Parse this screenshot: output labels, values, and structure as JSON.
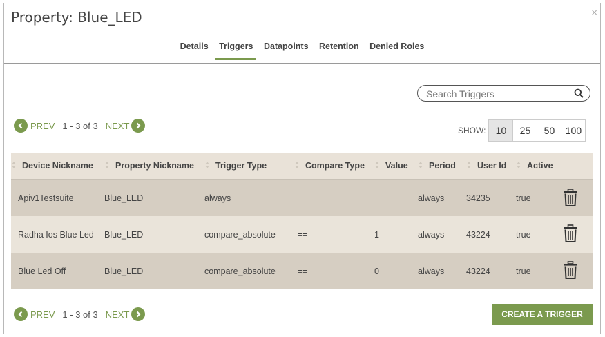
{
  "dialog": {
    "title": "Property: Blue_LED",
    "close_glyph": "×"
  },
  "tabs": [
    {
      "label": "Details",
      "active": false
    },
    {
      "label": "Triggers",
      "active": true
    },
    {
      "label": "Datapoints",
      "active": false
    },
    {
      "label": "Retention",
      "active": false
    },
    {
      "label": "Denied Roles",
      "active": false
    }
  ],
  "search": {
    "placeholder": "Search Triggers",
    "value": "",
    "icon": "search-icon"
  },
  "pagination": {
    "prev_label": "PREV",
    "next_label": "NEXT",
    "range": "1 - 3 of 3"
  },
  "page_size": {
    "label": "SHOW:",
    "options": [
      "10",
      "25",
      "50",
      "100"
    ],
    "selected": "10"
  },
  "table": {
    "columns": [
      "Device Nickname",
      "Property Nickname",
      "Trigger Type",
      "Compare Type",
      "Value",
      "Period",
      "User Id",
      "Active"
    ],
    "rows": [
      {
        "device": "Apiv1Testsuite",
        "property": "Blue_LED",
        "trigger_type": "always",
        "compare_type": "",
        "value": "",
        "period": "always",
        "user_id": "34235",
        "active": "true"
      },
      {
        "device": "Radha Ios Blue Led",
        "property": "Blue_LED",
        "trigger_type": "compare_absolute",
        "compare_type": "==",
        "value": "1",
        "period": "always",
        "user_id": "43224",
        "active": "true"
      },
      {
        "device": "Blue Led Off",
        "property": "Blue_LED",
        "trigger_type": "compare_absolute",
        "compare_type": "==",
        "value": "0",
        "period": "always",
        "user_id": "43224",
        "active": "true"
      }
    ]
  },
  "actions": {
    "create_label": "CREATE A TRIGGER"
  },
  "colors": {
    "accent": "#7b9a4e",
    "row_dark": "#d6cec2",
    "row_light": "#eae4da",
    "header_bg": "#e9e2d8"
  }
}
